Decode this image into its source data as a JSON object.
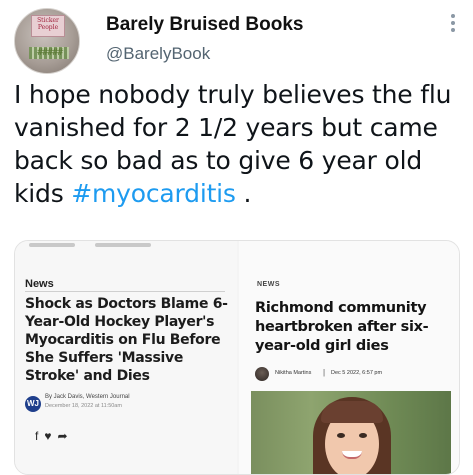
{
  "header": {
    "display_name": "Barely Bruised Books",
    "handle": "@BarelyBook",
    "avatar_cover_text": "Sticker People",
    "avatar_cover_marks": "##### ",
    "more_icon": "more-vertical-icon"
  },
  "tweet": {
    "text_before": "I hope nobody truly believes the flu vanished for 2 1/2 years but came back so bad as to give 6 year old kids ",
    "hashtag": "#myocarditis",
    "text_after": " ."
  },
  "left_article": {
    "section": "News",
    "headline": "Shock as Doctors Blame 6-Year-Old Hockey Player's Myocarditis on Flu Before She Suffers 'Massive Stroke' and Dies",
    "logo_text": "WJ",
    "byline": "By Jack Davis, Western Journal",
    "date": "December 18, 2022 at 11:50am",
    "share_icons": [
      "facebook-icon",
      "twitter-icon",
      "share-icon"
    ]
  },
  "right_article": {
    "section": "NEWS",
    "headline": "Richmond community heartbroken after six-year-old girl dies",
    "author": "Nikitha Martins",
    "separator": "|",
    "date": "Dec 5 2022, 6:57 pm"
  },
  "colors": {
    "hashtag": "#1d9bf0",
    "handle": "#536471",
    "text": "#0f1419"
  }
}
